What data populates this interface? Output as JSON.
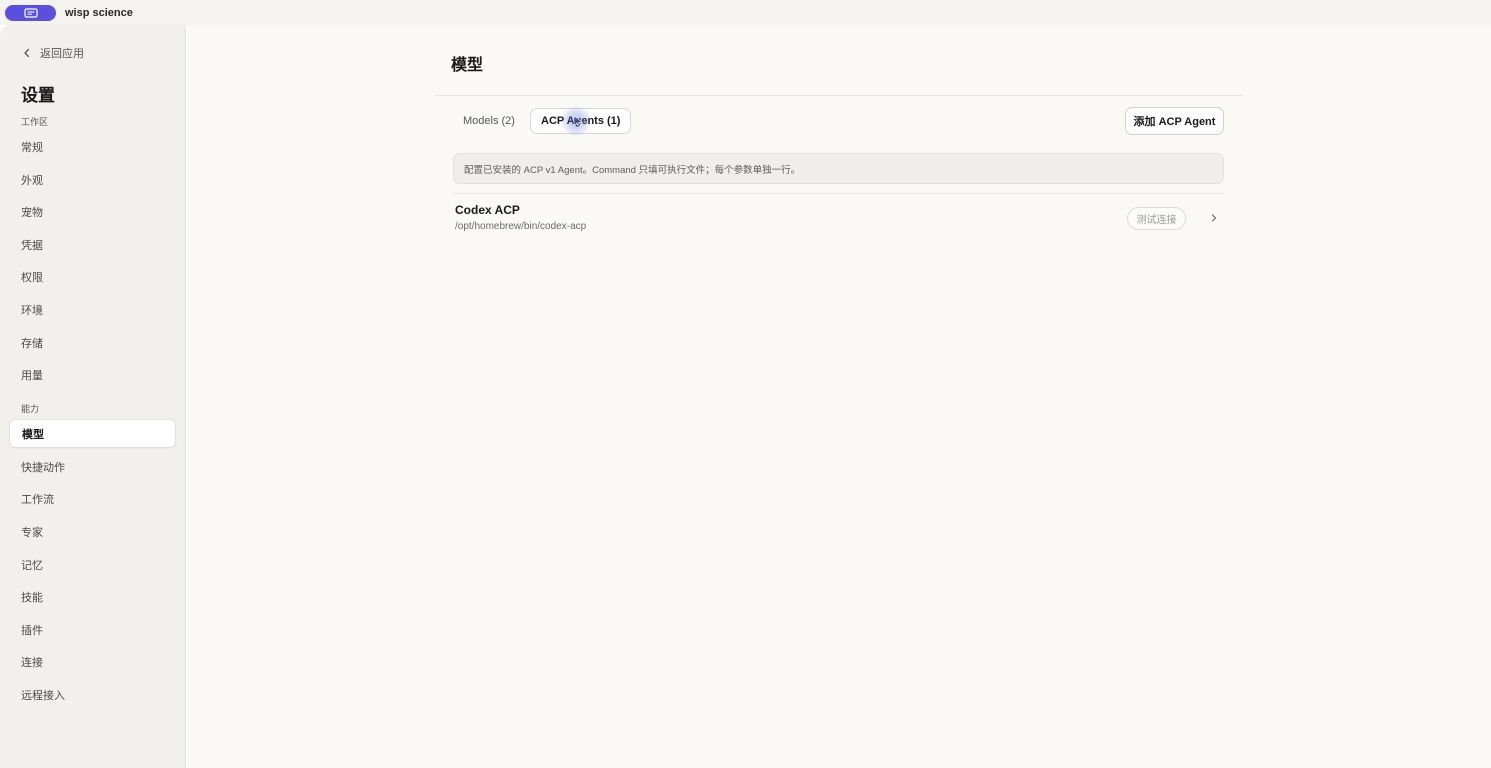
{
  "app": {
    "name": "wisp science",
    "icon": "app-window-icon",
    "accent": "#5b4fe0"
  },
  "sidebar": {
    "back_label": "返回应用",
    "title": "设置",
    "sections": [
      {
        "label": "工作区",
        "items": [
          "常规",
          "外观",
          "宠物",
          "凭据",
          "权限",
          "环境",
          "存储",
          "用量"
        ]
      },
      {
        "label": "能力",
        "items": [
          "模型",
          "快捷动作",
          "工作流",
          "专家",
          "记忆",
          "技能",
          "插件",
          "连接",
          "远程接入"
        ]
      }
    ],
    "active_item": "模型"
  },
  "main": {
    "title": "模型",
    "tabs": [
      {
        "label": "Models (2)",
        "active": false
      },
      {
        "label": "ACP Agents (1)",
        "active": true
      }
    ],
    "add_button_label": "添加 ACP Agent",
    "info_text": "配置已安装的 ACP v1 Agent。Command 只填可执行文件；每个参数单独一行。",
    "agents": [
      {
        "name": "Codex ACP",
        "path": "/opt/homebrew/bin/codex-acp",
        "test_label": "测试连接"
      }
    ]
  }
}
